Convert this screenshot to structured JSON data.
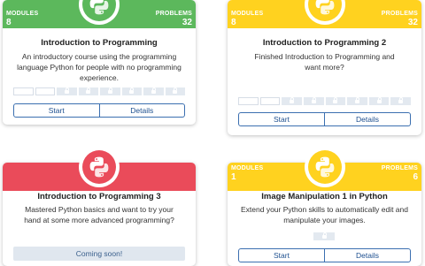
{
  "colors": {
    "green": "#5cb85c",
    "yellow": "#ffd21f",
    "red": "#ea4b5a"
  },
  "icons": {
    "logo": "python-logo-icon",
    "lock": "lock-icon"
  },
  "labels": {
    "modules": "MODULES",
    "problems": "PROBLEMS"
  },
  "cards": [
    {
      "modules": "8",
      "problems": "32",
      "title": "Introduction to Programming",
      "description": "An introductory course using the programming language Python for people with no programming experience.",
      "start_label": "Start",
      "details_label": "Details"
    },
    {
      "modules": "8",
      "problems": "32",
      "title": "Introduction to Programming 2",
      "description": "Finished Introduction to Programming and want more?",
      "start_label": "Start",
      "details_label": "Details"
    },
    {
      "title": "Introduction to Programming 3",
      "description": "Mastered Python basics and want to try your hand at some more advanced programming?",
      "status_label": "Coming soon!"
    },
    {
      "modules": "1",
      "problems": "6",
      "title": "Image Manipulation 1 in Python",
      "description": "Extend your Python skills to automatically edit and manipulate your images.",
      "start_label": "Start",
      "details_label": "Details"
    }
  ]
}
